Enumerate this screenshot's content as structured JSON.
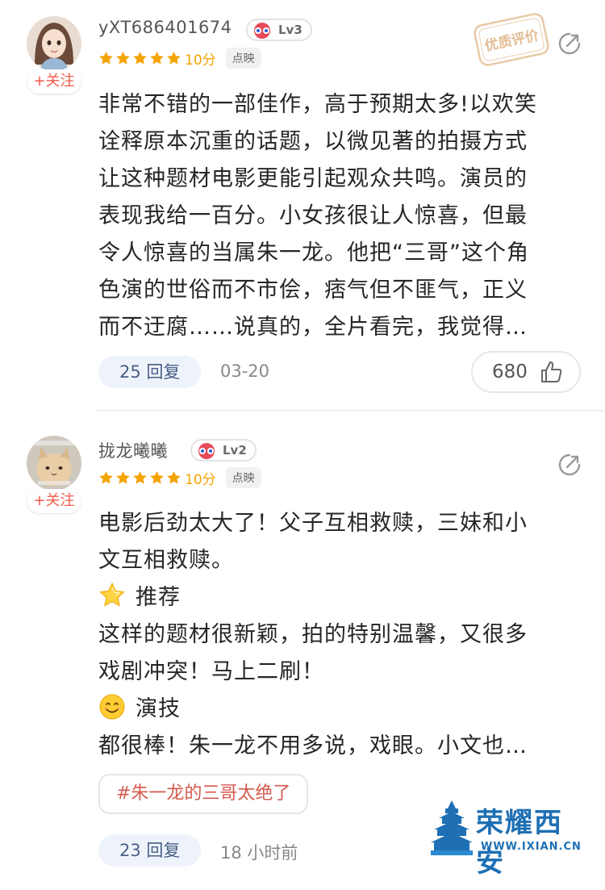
{
  "reviews": [
    {
      "username": "yXT686401674",
      "level": "Lv3",
      "follow_label": "+关注",
      "score": "10分",
      "source": "点映",
      "stars": 5,
      "quality_badge": "优质评价",
      "body_lines": [
        "非常不错的一部佳作，高于预期太多!以欢笑",
        "诠释原本沉重的话题，以微见著的拍摄方式",
        "让这种题材电影更能引起观众共鸣。演员的",
        "表现我给一百分。小女孩很让人惊喜，但最",
        "令人惊喜的当属朱一龙。他把“三哥”这个角",
        "色演的世俗而不市侩，痞气但不匪气，正义",
        "而不迂腐……说真的，全片看完，我觉得…"
      ],
      "replies": "25 回复",
      "time": "03-20",
      "likes": "680"
    },
    {
      "username": "拢龙曦曦",
      "level": "Lv2",
      "follow_label": "+关注",
      "score": "10分",
      "source": "点映",
      "stars": 5,
      "body_lines": [
        "电影后劲太大了！父子互相救赎，三妹和小",
        "文互相救赎。",
        "推荐",
        "这样的题材很新颖，拍的特别温馨，又很多",
        "戏剧冲突！马上二刷！",
        "演技",
        "都很棒！朱一龙不用多说，戏眼。小文也…"
      ],
      "hashtag": "#朱一龙的三哥太绝了",
      "replies": "23 回复",
      "time": "18 小时前"
    }
  ],
  "watermark": {
    "title": "荣耀西安",
    "url": "WWW.IXIAN.CN"
  },
  "colors": {
    "star": "#f5a300",
    "follow": "#f05a4a",
    "reply_bg": "#eef3fb",
    "hashtag": "#d45a4e",
    "watermark": "#1e6fb4"
  }
}
